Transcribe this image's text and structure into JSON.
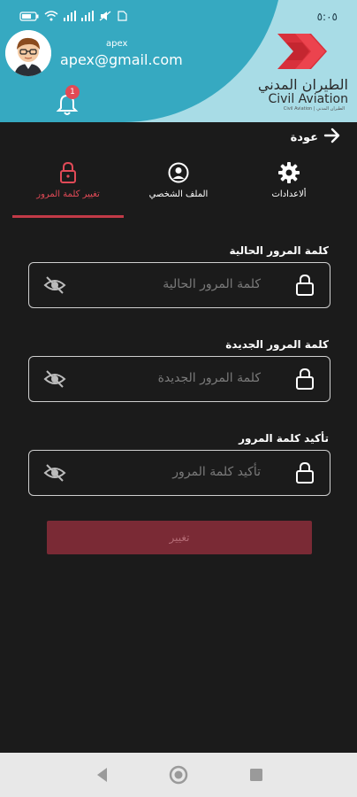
{
  "status": {
    "left_icons": [
      "battery-icon",
      "wifi-icon",
      "signal-icon",
      "signal-icon",
      "mute-icon",
      "sim-icon"
    ],
    "clock": "٥:٠٥"
  },
  "profile": {
    "username": "apex",
    "email": "apex@gmail.com",
    "notification_count": "1"
  },
  "logo": {
    "arabic": "الطيران المدني",
    "english": "Civil Aviation",
    "sub": "Civil Aviation | الطيران المدني"
  },
  "back": {
    "label": "عودة"
  },
  "tabs": [
    {
      "label": "تغيير كلمة المرور",
      "icon": "lock-icon",
      "active": true
    },
    {
      "label": "الملف الشخصي",
      "icon": "profile-icon",
      "active": false
    },
    {
      "label": "ألاعدادات",
      "icon": "gear-icon",
      "active": false
    }
  ],
  "fields": {
    "current": {
      "label": "كلمة المرور الحالية",
      "placeholder": "كلمة المرور الحالية"
    },
    "new": {
      "label": "كلمة المرور الجديدة",
      "placeholder": "كلمة المرور الجديدة"
    },
    "confirm": {
      "label": "تأكيد كلمة المرور",
      "placeholder": "تأكيد كلمة المرور"
    }
  },
  "submit": {
    "label": "تغيير"
  },
  "colors": {
    "accent": "#c23a47",
    "header_dark": "#36a9c1",
    "header_light": "#a8dce6",
    "background": "#1b1b1b"
  }
}
